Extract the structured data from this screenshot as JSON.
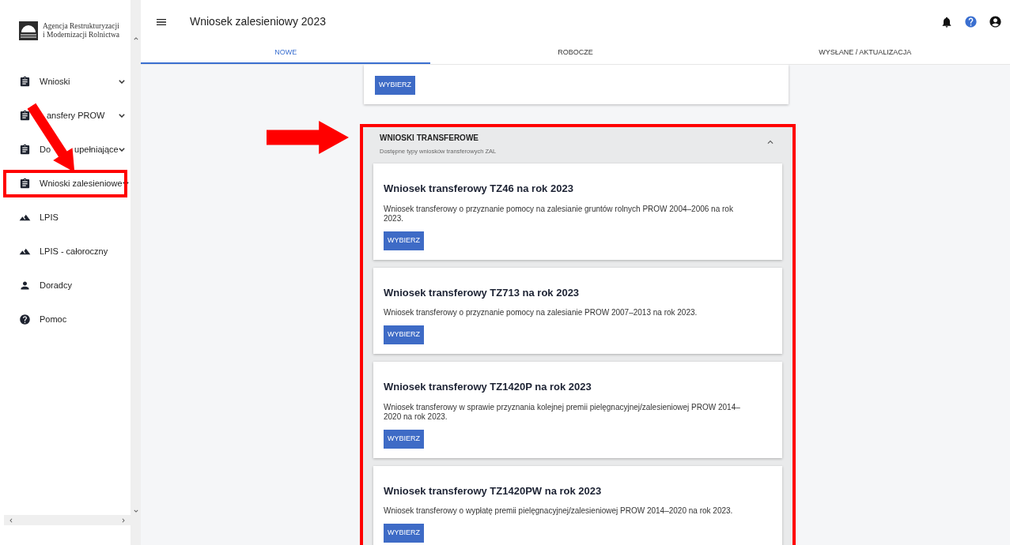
{
  "logo": {
    "line1": "Agencja Restrukturyzacji",
    "line2": "i Modernizacji Rolnictwa"
  },
  "header": {
    "title": "Wniosek zalesieniowy 2023"
  },
  "tabs": [
    {
      "label": "NOWE",
      "selected": true
    },
    {
      "label": "ROBOCZE",
      "selected": false
    },
    {
      "label": "WYSŁANE / AKTUALIZACJA",
      "selected": false
    }
  ],
  "sidebar": {
    "items": [
      {
        "label_parts": [
          "Wnioski"
        ],
        "kind": "clipboard",
        "expandable": true,
        "highlighted": false,
        "arrow": false
      },
      {
        "label_parts": [
          "ansfery PROW"
        ],
        "kind": "clipboard",
        "expandable": true,
        "highlighted": false,
        "arrow": false
      },
      {
        "label_parts": [
          "Do",
          "upełniające"
        ],
        "kind": "clipboard",
        "expandable": true,
        "highlighted": false,
        "arrow": false
      },
      {
        "label_parts": [
          "Wnioski zalesieniowe"
        ],
        "kind": "clipboard",
        "expandable": true,
        "highlighted": true,
        "arrow": true
      },
      {
        "label_parts": [
          "LPIS"
        ],
        "kind": "terrain",
        "expandable": false,
        "highlighted": false,
        "arrow": false
      },
      {
        "label_parts": [
          "LPIS - całoroczny"
        ],
        "kind": "terrain",
        "expandable": false,
        "highlighted": false,
        "arrow": false
      },
      {
        "label_parts": [
          "Doradcy"
        ],
        "kind": "person",
        "expandable": false,
        "highlighted": false,
        "arrow": false
      },
      {
        "label_parts": [
          "Pomoc"
        ],
        "kind": "help",
        "expandable": false,
        "highlighted": false,
        "arrow": false
      }
    ]
  },
  "previous_card": {
    "button": "WYBIERZ"
  },
  "panel": {
    "title": "WNIOSKI TRANSFEROWE",
    "subtitle": "Dostępne typy wniosków transferowych ZAL",
    "expanded": true,
    "highlighted": true,
    "arrow": true,
    "cards": [
      {
        "title": "Wniosek transferowy TZ46 na rok 2023",
        "text": "Wniosek transferowy o przyznanie pomocy na zalesianie gruntów rolnych PROW 2004–2006 na rok 2023.",
        "button": "WYBIERZ"
      },
      {
        "title": "Wniosek transferowy TZ713 na rok 2023",
        "text": "Wniosek transferowy o przyznanie pomocy na zalesianie PROW 2007–2013 na rok 2023.",
        "button": "WYBIERZ"
      },
      {
        "title": "Wniosek transferowy TZ1420P na rok 2023",
        "text": "Wniosek transferowy w sprawie przyznania kolejnej premii pielęgnacyjnej/zalesieniowej PROW 2014–2020 na rok 2023.",
        "button": "WYBIERZ"
      },
      {
        "title": "Wniosek transferowy TZ1420PW na rok 2023",
        "text": "Wniosek transferowy o wypłatę premii pielęgnacyjnej/zalesieniowej PROW 2014–2020 na rok 2023.",
        "button": "WYBIERZ"
      }
    ]
  }
}
